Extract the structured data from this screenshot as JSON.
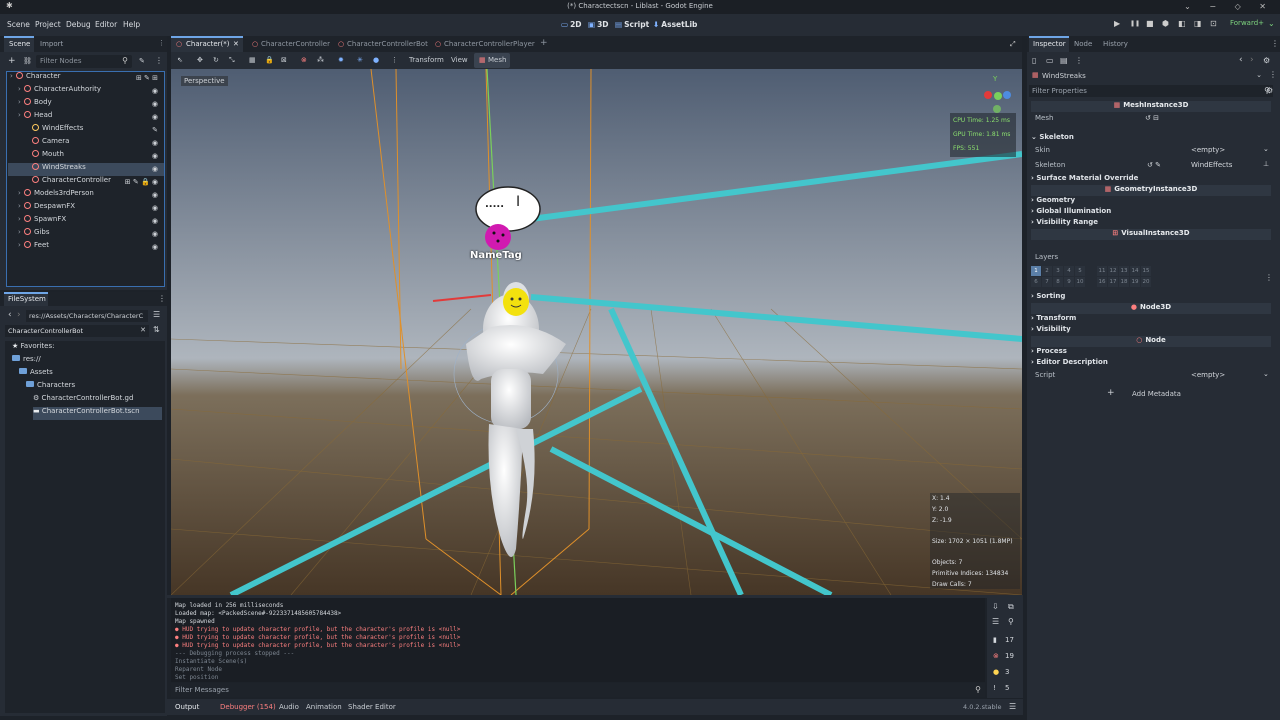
{
  "window": {
    "title": "(*) Charactectscn - Liblast - Godot Engine",
    "pin_glyph": "✱",
    "controls_glyph": "⌄ − ◇ ✕"
  },
  "menu": [
    "Scene",
    "Project",
    "Debug",
    "Editor",
    "Help"
  ],
  "workspaces": [
    {
      "icon": "▭",
      "label": "2D"
    },
    {
      "icon": "▣",
      "label": "3D"
    },
    {
      "icon": "▤",
      "label": "Script"
    },
    {
      "icon": "⬇",
      "label": "AssetLib"
    }
  ],
  "run_toolbar": {
    "play": "▶",
    "pause": "❚❚",
    "stop": "■",
    "remote": "⬢",
    "movie": "◧",
    "scene_play": "◨",
    "custom_play": "⊡",
    "renderer": "Forward+",
    "renderer_caret": "⌄"
  },
  "scene_dock": {
    "tabs": [
      "Scene",
      "Import"
    ],
    "filter_placeholder": "Filter Nodes",
    "add_icon": "+",
    "link_icon": "⛓",
    "search_icon": "⚲",
    "script_icon": "✎",
    "more_icon": "⋮",
    "nodes": [
      {
        "label": "Character",
        "indent": 0,
        "icon_color": "#fc7f7f",
        "right": "⊞ ✎ ⊞"
      },
      {
        "label": "CharacterAuthority",
        "indent": 1,
        "icon_color": "#fc7f7f",
        "right": "◉"
      },
      {
        "label": "Body",
        "indent": 1,
        "icon_color": "#fc7f7f",
        "right": "◉"
      },
      {
        "label": "Head",
        "indent": 1,
        "icon_color": "#fc7f7f",
        "right": "◉"
      },
      {
        "label": "WindEffects",
        "indent": 2,
        "icon_color": "#ffca5f",
        "right": "✎"
      },
      {
        "label": "Camera",
        "indent": 2,
        "icon_color": "#fc7f7f",
        "right": "◉"
      },
      {
        "label": "Mouth",
        "indent": 2,
        "icon_color": "#fc7f7f",
        "right": "◉"
      },
      {
        "label": "WindStreaks",
        "indent": 2,
        "icon_color": "#fc7f7f",
        "right": "◉",
        "selected": true
      },
      {
        "label": "CharacterController",
        "indent": 2,
        "icon_color": "#fc7f7f",
        "right": "⊞ ✎ 🔒 ◉"
      },
      {
        "label": "Models3rdPerson",
        "indent": 1,
        "icon_color": "#fc7f7f",
        "right": "◉"
      },
      {
        "label": "DespawnFX",
        "indent": 1,
        "icon_color": "#fc7f7f",
        "right": "◉"
      },
      {
        "label": "SpawnFX",
        "indent": 1,
        "icon_color": "#fc7f7f",
        "right": "◉"
      },
      {
        "label": "Gibs",
        "indent": 1,
        "icon_color": "#fc7f7f",
        "right": "◉"
      },
      {
        "label": "Feet",
        "indent": 1,
        "icon_color": "#fc7f7f",
        "right": "◉"
      }
    ]
  },
  "filesystem": {
    "tab": "FileSystem",
    "path": "res://Assets/Characters/CharacterC",
    "search_value": "CharacterControllerBot",
    "nav_back": "‹",
    "nav_fwd": "›",
    "clear_icon": "✕",
    "list_icon": "☰",
    "sort_icon": "⇅",
    "items": [
      {
        "label": "Favorites:",
        "level": 0,
        "kind": "star"
      },
      {
        "label": "res://",
        "level": 0,
        "kind": "folder"
      },
      {
        "label": "Assets",
        "level": 1,
        "kind": "folder"
      },
      {
        "label": "Characters",
        "level": 2,
        "kind": "folder"
      },
      {
        "label": "CharacterControllerBot.gd",
        "level": 3,
        "kind": "gear"
      },
      {
        "label": "CharacterControllerBot.tscn",
        "level": 3,
        "kind": "scene",
        "selected": true
      }
    ]
  },
  "scene_tabs": [
    {
      "label": "Character(*)",
      "active": true,
      "close": "✕"
    },
    {
      "label": "CharacterController"
    },
    {
      "label": "CharacterControllerBot"
    },
    {
      "label": "CharacterControllerPlayer"
    }
  ],
  "scene_tabs_add": "+",
  "scene_tabs_fullscreen": "⤢",
  "viewport_toolbar": {
    "tools": [
      "⇖",
      "✥",
      "↻",
      "⤡",
      "▦",
      "🔒",
      "⊠",
      "⁂",
      "⊗",
      "✳",
      "●",
      "✹",
      "⋮"
    ],
    "transform": "Transform",
    "view": "View",
    "mesh": "Mesh"
  },
  "viewport": {
    "perspective": "Perspective",
    "stats": {
      "cpu": "CPU Time: 1.25 ms",
      "gpu": "GPU Time: 1.81 ms",
      "fps": "FPS: 551"
    },
    "gizmo_y": "Y",
    "nametag": "NameTag",
    "bubble_text": ".....",
    "cursor": "I",
    "coords": {
      "x": "X: 1.4",
      "y": "Y: 2.0",
      "z": "Z: -1.9"
    },
    "size": "Size: 1702 × 1051 (1.8MP)",
    "objects": "Objects: 7",
    "primitives": "Primitive Indices: 134834",
    "drawcalls": "Draw Calls: 7"
  },
  "console": {
    "lines": [
      {
        "text": "Map loaded in 256 milliseconds",
        "kind": "normal"
      },
      {
        "text": "Loaded map: <PackedScene#-9223371485605784438>",
        "kind": "normal"
      },
      {
        "text": "Map spawned",
        "kind": "normal"
      },
      {
        "text": "HUD trying to update character profile, but the character's profile is <null>",
        "kind": "error"
      },
      {
        "text": "HUD trying to update character profile, but the character's profile is <null>",
        "kind": "error"
      },
      {
        "text": "HUD trying to update character profile, but the character's profile is <null>",
        "kind": "error"
      },
      {
        "text": "--- Debugging process stopped ---",
        "kind": "dim"
      },
      {
        "text": "Instantiate Scene(s)",
        "kind": "dim"
      },
      {
        "text": "Reparent Node",
        "kind": "dim"
      },
      {
        "text": "Set position",
        "kind": "dim"
      }
    ],
    "filter_placeholder": "Filter Messages",
    "search_icon": "⚲",
    "counts": [
      {
        "icon": "▮",
        "value": "17",
        "color": "#d4d8dd"
      },
      {
        "icon": "⊗",
        "value": "19",
        "color": "#fc7f7f"
      },
      {
        "icon": "●",
        "value": "3",
        "color": "#ffd452"
      },
      {
        "icon": "!",
        "value": "5",
        "color": "#d4d8dd"
      }
    ],
    "side_icons": [
      "⇩",
      "⧉",
      "☰",
      "⚲"
    ]
  },
  "bottom_tabs": [
    {
      "label": "Output",
      "active": true
    },
    {
      "label": "Debugger (154)",
      "warn": true
    },
    {
      "label": "Audio"
    },
    {
      "label": "Animation"
    },
    {
      "label": "Shader Editor"
    }
  ],
  "version": "4.0.2.stable",
  "version_icon": "☰",
  "inspector": {
    "tabs": [
      "Inspector",
      "Node",
      "History"
    ],
    "node_name": "WindStreaks",
    "filter_placeholder": "Filter Properties",
    "toolbar_icons": [
      "▯",
      "▭",
      "▤",
      "⋮"
    ],
    "nav": [
      "‹",
      "›",
      "⚙"
    ],
    "sections": [
      {
        "type": "cat",
        "label": "MeshInstance3D",
        "icon": "▦"
      },
      {
        "type": "prop",
        "label": "Mesh",
        "value": "↺ ⊟"
      },
      {
        "type": "group",
        "label": "Skeleton",
        "open": true
      },
      {
        "type": "prop",
        "label": "Skin",
        "value": "<empty>",
        "caret": "⌄"
      },
      {
        "type": "prop",
        "label": "Skeleton",
        "value": "WindEffects",
        "prefix": "↺ ✎",
        "suffix": "⊥"
      },
      {
        "type": "sub",
        "label": "Surface Material Override"
      },
      {
        "type": "cat",
        "label": "GeometryInstance3D",
        "icon": "▦"
      },
      {
        "type": "sub",
        "label": "Geometry"
      },
      {
        "type": "sub",
        "label": "Global Illumination"
      },
      {
        "type": "sub",
        "label": "Visibility Range"
      },
      {
        "type": "cat",
        "label": "VisualInstance3D",
        "icon": "⊞"
      }
    ],
    "layers_label": "Layers",
    "layers_row1": [
      "1",
      "2",
      "3",
      "4",
      "5",
      "",
      "11",
      "12",
      "13",
      "14",
      "15"
    ],
    "layers_row2": [
      "6",
      "7",
      "8",
      "9",
      "10",
      "",
      "16",
      "17",
      "18",
      "19",
      "20"
    ],
    "layers_more": "⋮",
    "sections2": [
      {
        "type": "sub",
        "label": "Sorting"
      },
      {
        "type": "cat",
        "label": "Node3D",
        "icon": "●"
      },
      {
        "type": "sub",
        "label": "Transform"
      },
      {
        "type": "sub",
        "label": "Visibility"
      },
      {
        "type": "cat",
        "label": "Node",
        "icon": "○"
      },
      {
        "type": "sub",
        "label": "Process"
      },
      {
        "type": "sub",
        "label": "Editor Description"
      },
      {
        "type": "prop",
        "label": "Script",
        "value": "<empty>",
        "caret": "⌄"
      }
    ],
    "add_metadata": "Add Metadata",
    "add_icon": "+"
  }
}
